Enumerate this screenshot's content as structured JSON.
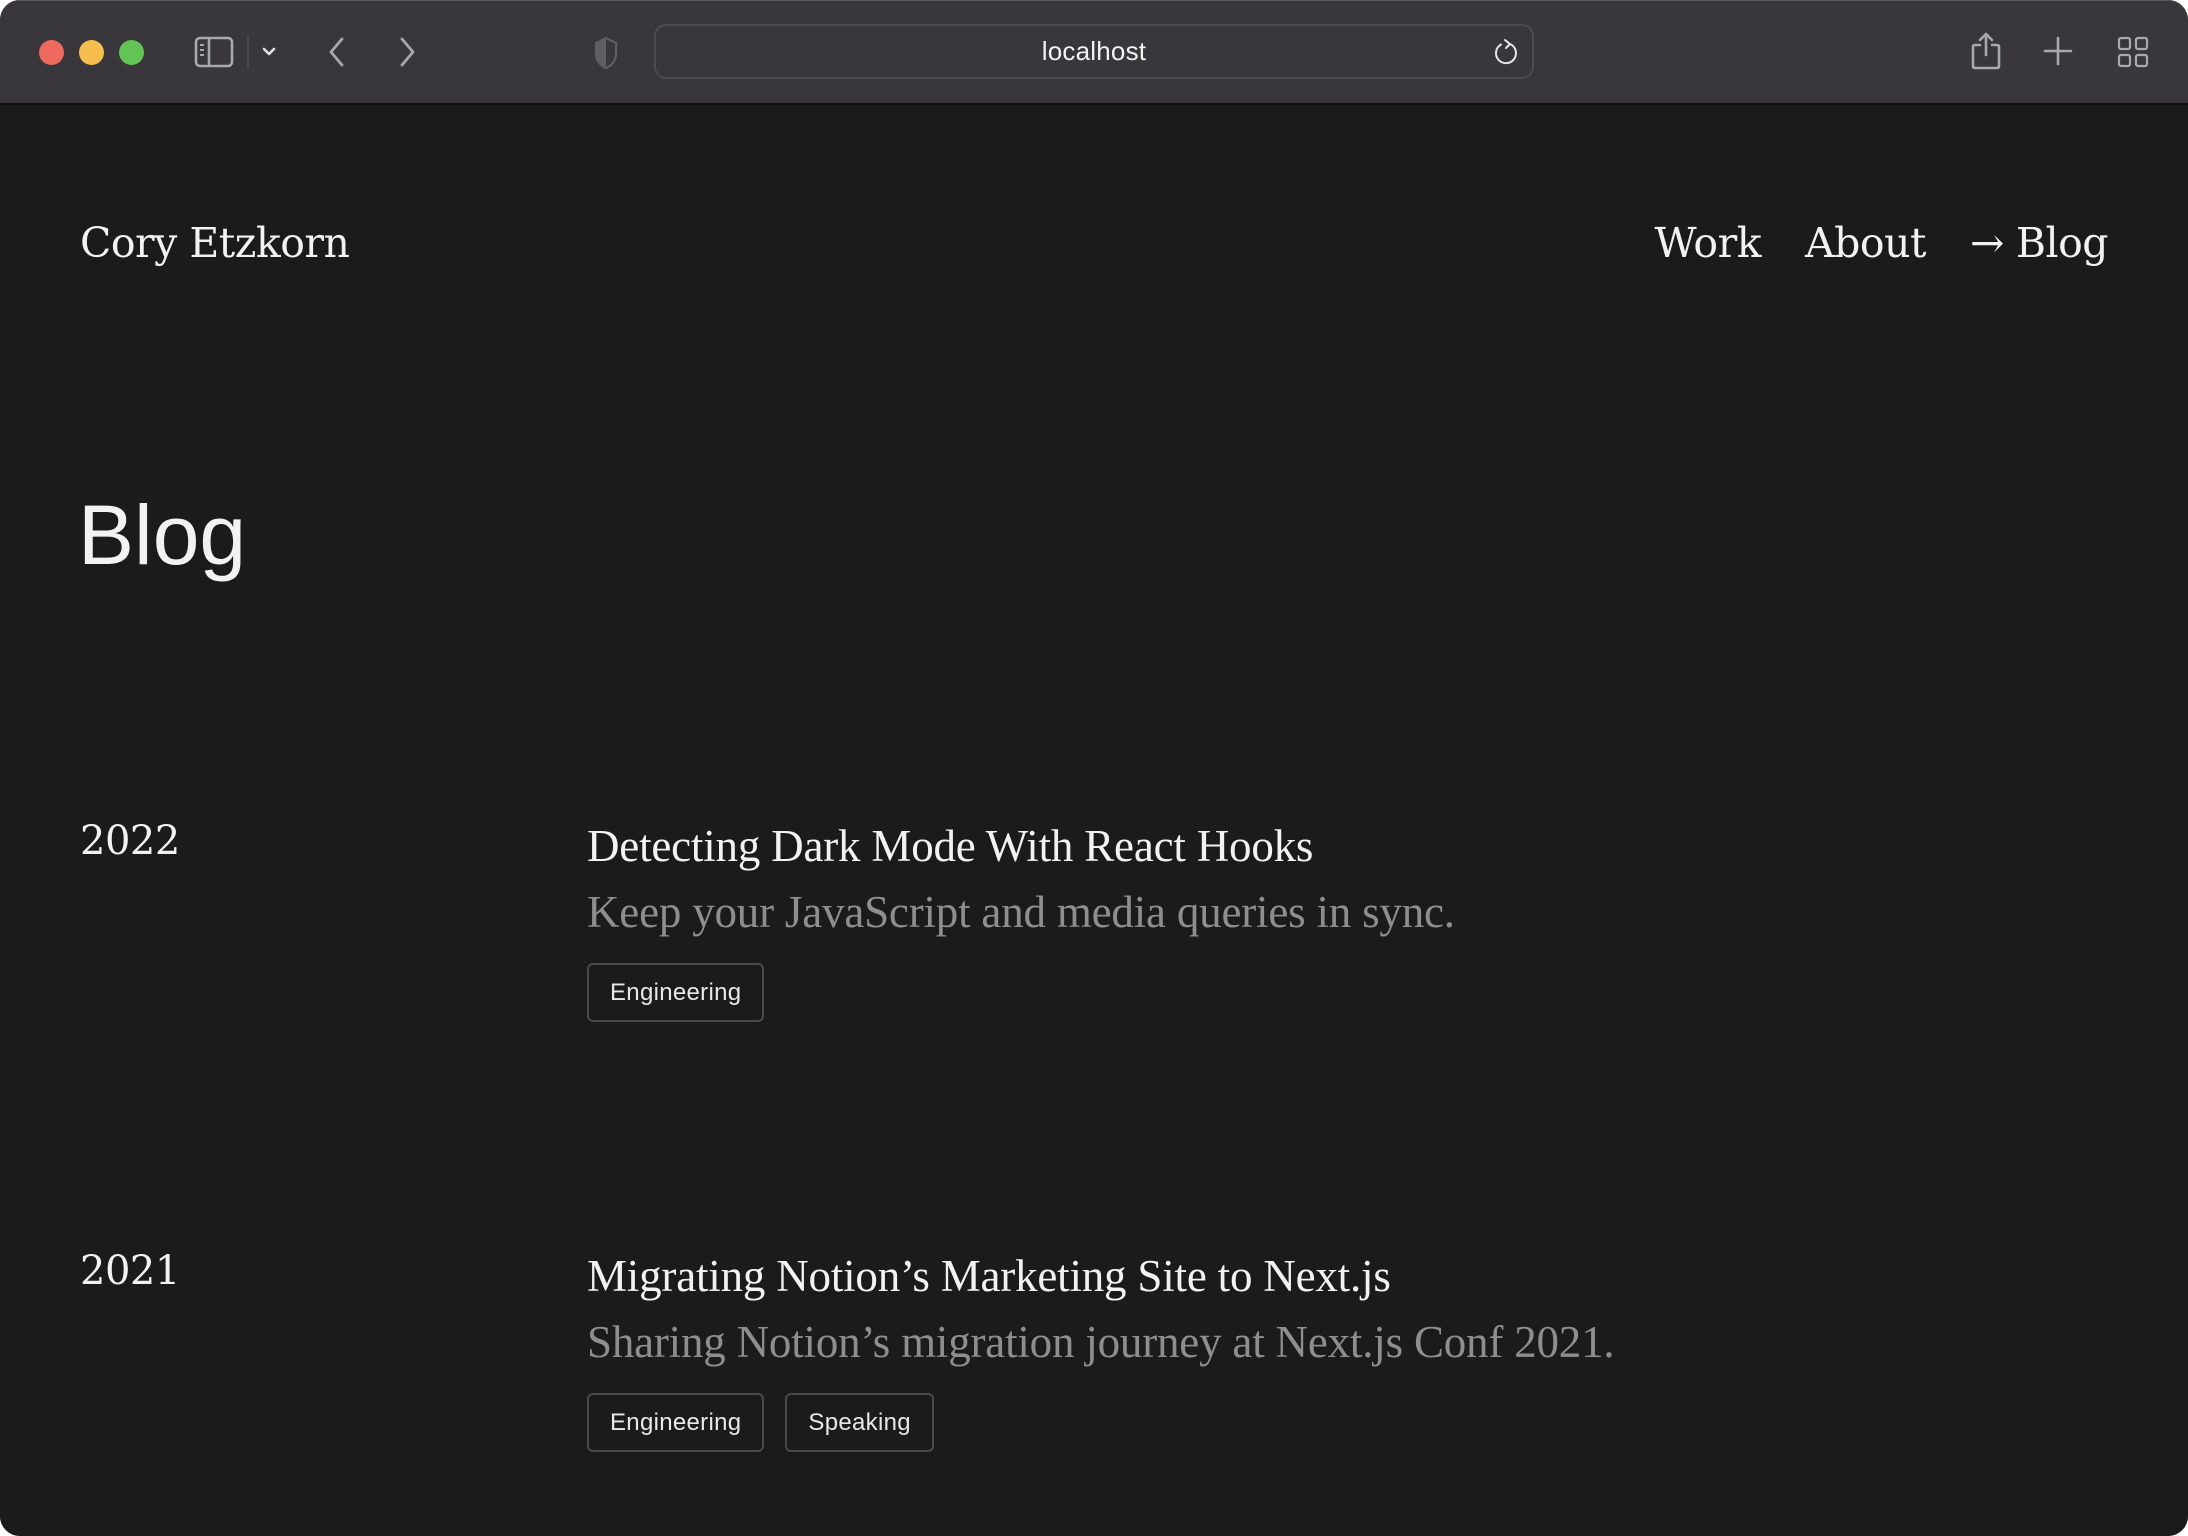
{
  "browser": {
    "url": "localhost",
    "icons": {
      "close": "traffic-light-close",
      "minimize": "traffic-light-minimize",
      "zoom": "traffic-light-zoom",
      "sidebar": "sidebar-icon",
      "sidebar_menu": "chevron-down-icon",
      "back": "chevron-left-icon",
      "forward": "chevron-right-icon",
      "privacy": "shield-icon",
      "reload": "reload-icon",
      "share": "share-icon",
      "new_tab": "plus-icon",
      "tab_overview": "grid-icon"
    },
    "colors": {
      "close": "#ee6a5f",
      "minimize": "#f5be4f",
      "zoom": "#61c454",
      "toolbar_bg": "#39373b"
    }
  },
  "site": {
    "name": "Cory Etzkorn",
    "nav": [
      {
        "label": "Work",
        "active": false
      },
      {
        "label": "About",
        "active": false
      },
      {
        "label": "Blog",
        "active": true,
        "marker": "→"
      }
    ]
  },
  "page": {
    "title": "Blog",
    "background": "#1b1b1b"
  },
  "posts": [
    {
      "year": "2022",
      "title": "Detecting Dark Mode With React Hooks",
      "description": "Keep your JavaScript and media queries in sync.",
      "tags": [
        "Engineering"
      ]
    },
    {
      "year": "2021",
      "title": "Migrating Notion’s Marketing Site to Next.js",
      "description": "Sharing Notion’s migration journey at Next.js Conf 2021.",
      "tags": [
        "Engineering",
        "Speaking"
      ]
    }
  ]
}
